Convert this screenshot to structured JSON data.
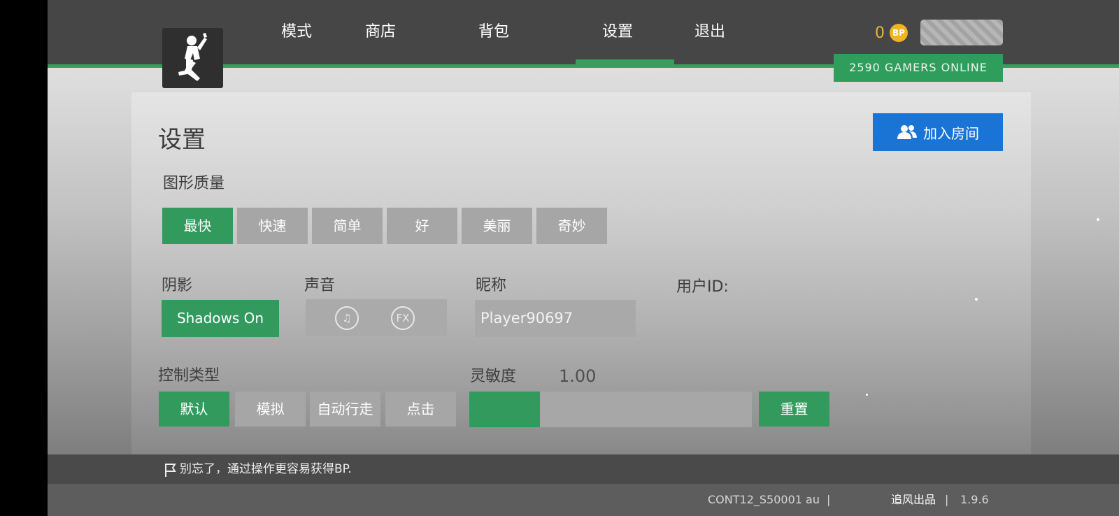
{
  "nav": {
    "items": [
      {
        "label": "模式"
      },
      {
        "label": "商店"
      },
      {
        "label": "背包"
      },
      {
        "label": "设置"
      },
      {
        "label": "退出"
      }
    ],
    "active": "设置"
  },
  "currency": {
    "amount": "0",
    "icon_text": "BP"
  },
  "online_banner": "2590 GAMERS ONLINE",
  "page": {
    "title": "设置"
  },
  "join_button": {
    "label": "加入房间",
    "icon": "users-icon"
  },
  "graphics": {
    "label": "图形质量",
    "options": [
      "最快",
      "快速",
      "简单",
      "好",
      "美丽",
      "奇妙"
    ],
    "selected": "最快"
  },
  "shadow": {
    "label": "阴影",
    "button": "Shadows On"
  },
  "sound": {
    "label": "声音",
    "icons": [
      "music-note-icon",
      "fx-icon"
    ],
    "fx_text": "FX"
  },
  "nickname": {
    "label": "昵称",
    "value": "Player90697"
  },
  "user_id": {
    "label": "用户ID:"
  },
  "control": {
    "label": "控制类型",
    "options": [
      "默认",
      "模拟",
      "自动行走",
      "点击"
    ],
    "selected": "默认"
  },
  "sensitivity": {
    "label": "灵敏度",
    "value": "1.00",
    "fill_fraction": 0.25,
    "reset_label": "重置"
  },
  "tip": {
    "text": "别忘了，通过操作更容易获得BP.",
    "icon": "flag-icon"
  },
  "footer": {
    "build": "CONT12_S50001 au",
    "separator": "|",
    "publisher": "追风出品",
    "version": "1.9.6"
  },
  "colors": {
    "accent_green": "#339a5e",
    "join_blue": "#1a74d6",
    "bp_gold": "#f2b322"
  }
}
